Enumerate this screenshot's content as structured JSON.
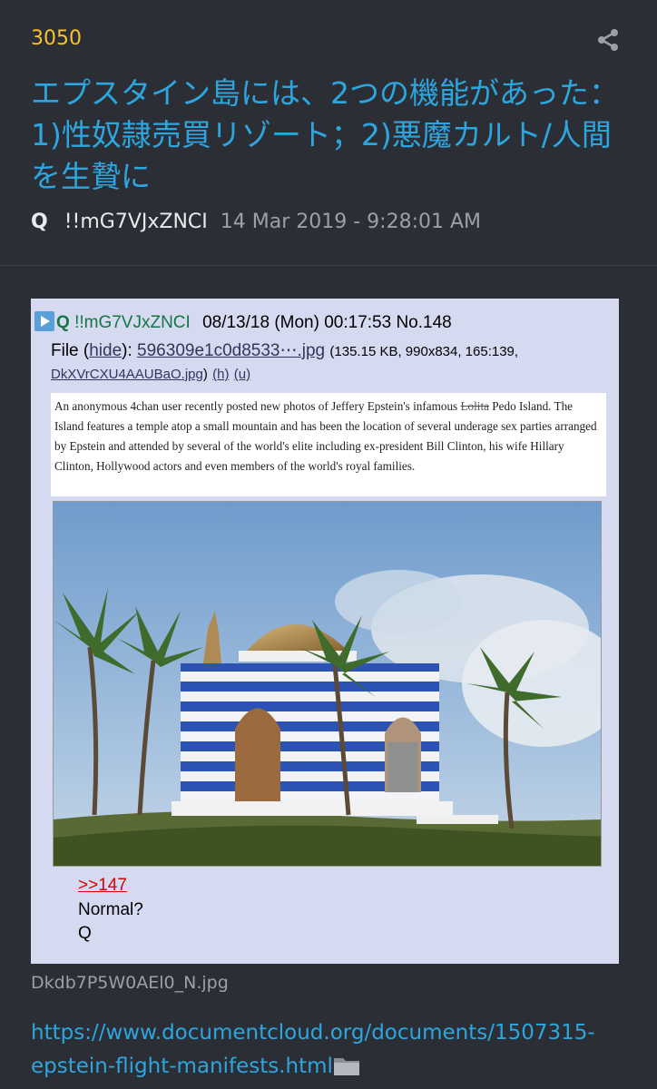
{
  "post": {
    "number": "3050",
    "title": "エプスタイン島には、2つの機能があった：1)性奴隷売買リゾート；2)悪魔カルト/人間を生贄に",
    "author": "Q",
    "tripcode": "!!mG7VJxZNCI",
    "timestamp": "14 Mar 2019 - 9:28:01 AM"
  },
  "embedded": {
    "name": "Q",
    "tripcode": "!!mG7VJxZNCI",
    "datetime": "08/13/18 (Mon) 00:17:53",
    "post_no": "No.148",
    "file_label": "File",
    "hide_label": "hide",
    "file_name": "596309e1c0d8533⋯.jpg",
    "file_meta": "(135.15 KB, 990x834, 165:139,",
    "orig_name": "DkXVrCXU4AAUBaO.jpg",
    "h_label": "(h)",
    "u_label": "(u)",
    "article_text_before": "An anonymous 4chan user recently posted new photos of Jeffery Epstein's infamous",
    "article_strike": "Lolita",
    "article_text_after": "Pedo Island. The Island features a temple atop a small mountain and has been the location of several underage sex parties arranged by Epstein and attended by several of the world's elite including ex-president Bill Clinton, his wife Hillary Clinton, Hollywood actors and even members of the world's royal families.",
    "reply_ref": ">>147",
    "reply_line1": "Normal?",
    "reply_line2": "Q"
  },
  "image_caption": "Dkdb7P5W0AEl0_N.jpg",
  "source_link": "https://www.documentcloud.org/documents/1507315-epstein-flight-manifests.html",
  "icons": {
    "share": "share-icon",
    "play": "play-icon",
    "folder": "folder-icon"
  },
  "colors": {
    "background": "#2b2f35",
    "title": "#2da6e0",
    "number": "#f5c231",
    "card": "#d6daf0",
    "name_green": "#117743",
    "reply_red": "#dd0000"
  }
}
